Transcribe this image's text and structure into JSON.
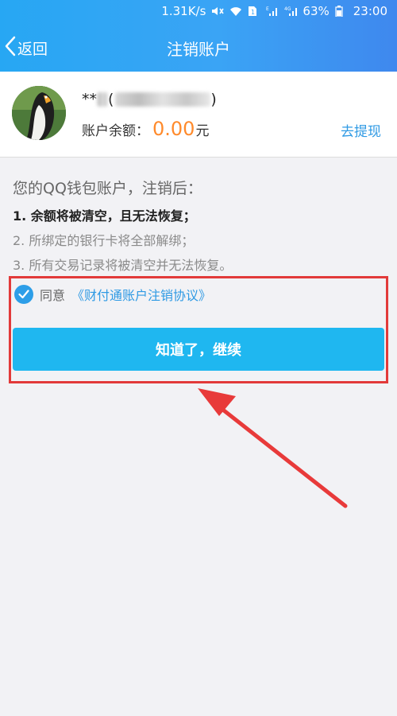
{
  "statusbar": {
    "speed": "1.31K/s",
    "battery": "63%",
    "time": "23:00"
  },
  "navbar": {
    "back_label": "返回",
    "title": "注销账户"
  },
  "account": {
    "name_prefix": "**",
    "name_paren_open": "(",
    "name_paren_close": ")",
    "balance_label": "账户余额：",
    "balance_value": "0.00",
    "balance_unit": "元",
    "withdraw_label": "去提现"
  },
  "notice": {
    "title": "您的QQ钱包账户，注销后：",
    "items": [
      "1. 余额将被清空，且无法恢复；",
      "2. 所绑定的银行卡将全部解绑；",
      "3. 所有交易记录将被清空并无法恢复。"
    ]
  },
  "agreement": {
    "agree_text": "同意",
    "link_text": "《财付通账户注销协议》"
  },
  "actions": {
    "continue_label": "知道了，继续"
  },
  "colors": {
    "accent_blue": "#1fb7f0",
    "link_blue": "#2f9ae4",
    "balance_orange": "#ff8a2b",
    "annotation_red": "#e23a3a"
  }
}
